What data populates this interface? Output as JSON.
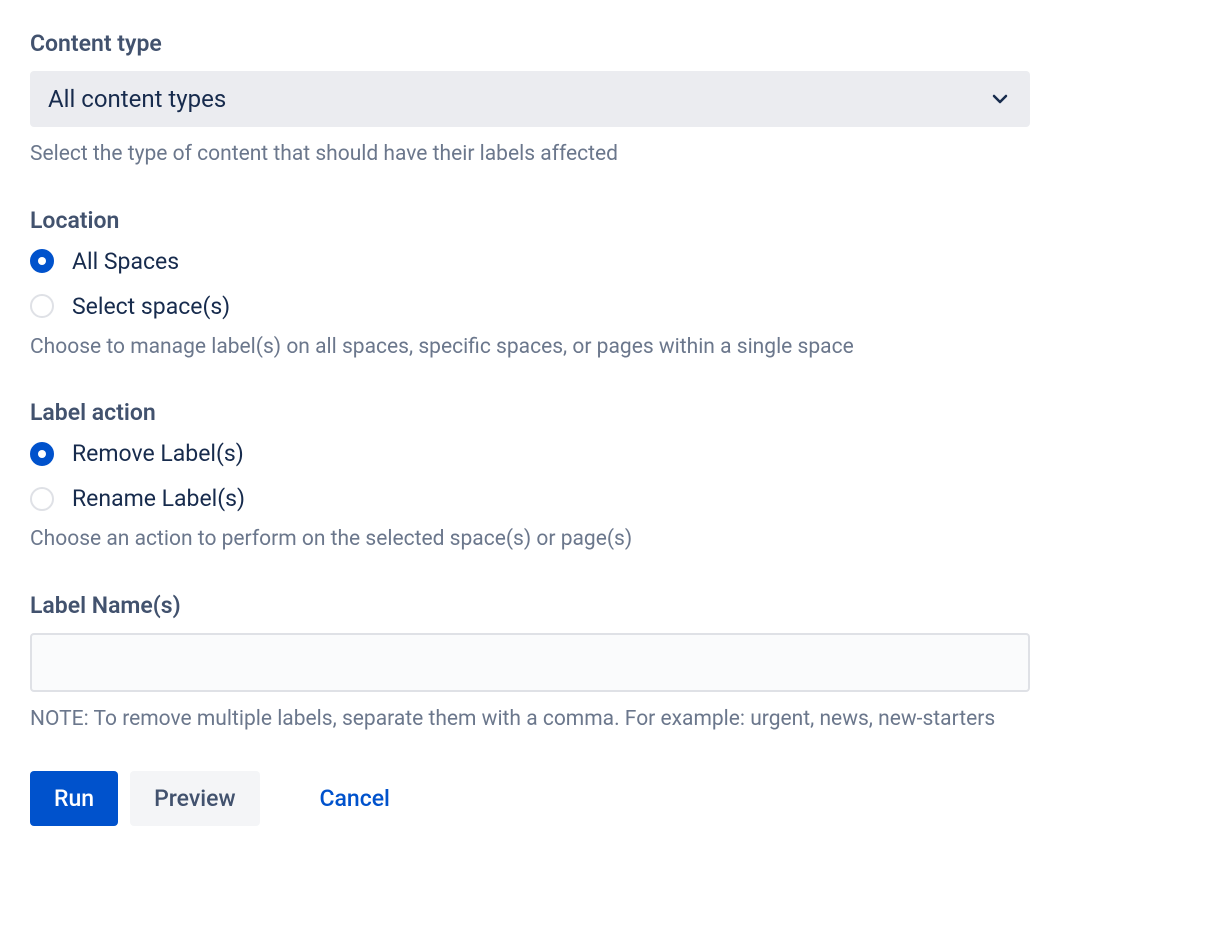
{
  "content_type": {
    "label": "Content type",
    "selected": "All content types",
    "helper": "Select the type of content that should have their labels affected"
  },
  "location": {
    "label": "Location",
    "options": [
      {
        "label": "All Spaces",
        "selected": true
      },
      {
        "label": "Select space(s)",
        "selected": false
      }
    ],
    "helper": "Choose to manage label(s) on all spaces, specific spaces, or pages within a single space"
  },
  "label_action": {
    "label": "Label action",
    "options": [
      {
        "label": "Remove Label(s)",
        "selected": true
      },
      {
        "label": "Rename Label(s)",
        "selected": false
      }
    ],
    "helper": "Choose an action to perform on the selected space(s) or page(s)"
  },
  "label_names": {
    "label": "Label Name(s)",
    "value": "",
    "helper": "NOTE: To remove multiple labels, separate them with a comma. For example: urgent, news, new-starters"
  },
  "buttons": {
    "run": "Run",
    "preview": "Preview",
    "cancel": "Cancel"
  }
}
